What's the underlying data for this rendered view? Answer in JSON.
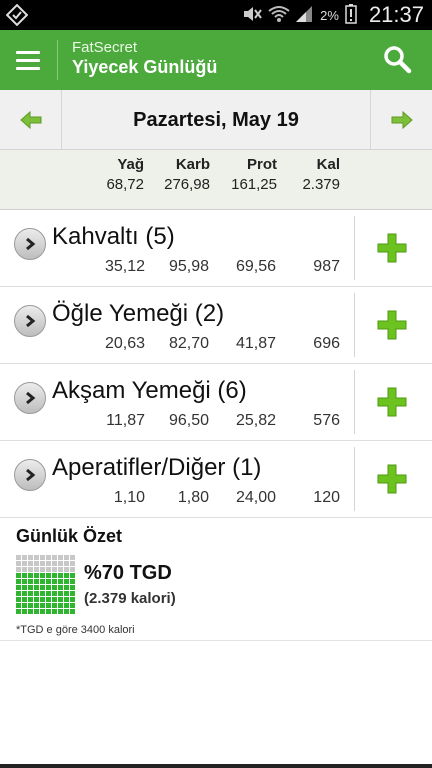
{
  "status_bar": {
    "left_icon": "app-notification-icon",
    "battery_percent": "2%",
    "time": "21:37"
  },
  "action_bar": {
    "app_name": "FatSecret",
    "title": "Yiyecek Günlüğü",
    "menu_icon": "menu-icon",
    "search_icon": "search-icon"
  },
  "date_nav": {
    "date": "Pazartesi, May 19",
    "prev_icon": "arrow-left-icon",
    "next_icon": "arrow-right-icon"
  },
  "totals": {
    "headers": [
      "Yağ",
      "Karb",
      "Prot",
      "Kal"
    ],
    "values": [
      "68,72",
      "276,98",
      "161,25",
      "2.379"
    ]
  },
  "meals": [
    {
      "name": "Kahvaltı (5)",
      "values": [
        "35,12",
        "95,98",
        "69,56",
        "987"
      ]
    },
    {
      "name": "Öğle Yemeği (2)",
      "values": [
        "20,63",
        "82,70",
        "41,87",
        "696"
      ]
    },
    {
      "name": "Akşam Yemeği (6)",
      "values": [
        "11,87",
        "96,50",
        "25,82",
        "576"
      ]
    },
    {
      "name": "Aperatifler/Diğer (1)",
      "values": [
        "1,10",
        "1,80",
        "24,00",
        "120"
      ]
    }
  ],
  "summary": {
    "title": "Günlük Özet",
    "percent": "%70 TGD",
    "calories": "(2.379 kalori)",
    "progress_fraction": 0.7,
    "footnote": "*TGD e göre 3400 kalori"
  },
  "colors": {
    "accent": "#4caa3c",
    "arrow": "#7cbf3a",
    "add": "#6cc21f",
    "grid_filled": "#2fb52f",
    "grid_empty": "#c8c8c8"
  }
}
